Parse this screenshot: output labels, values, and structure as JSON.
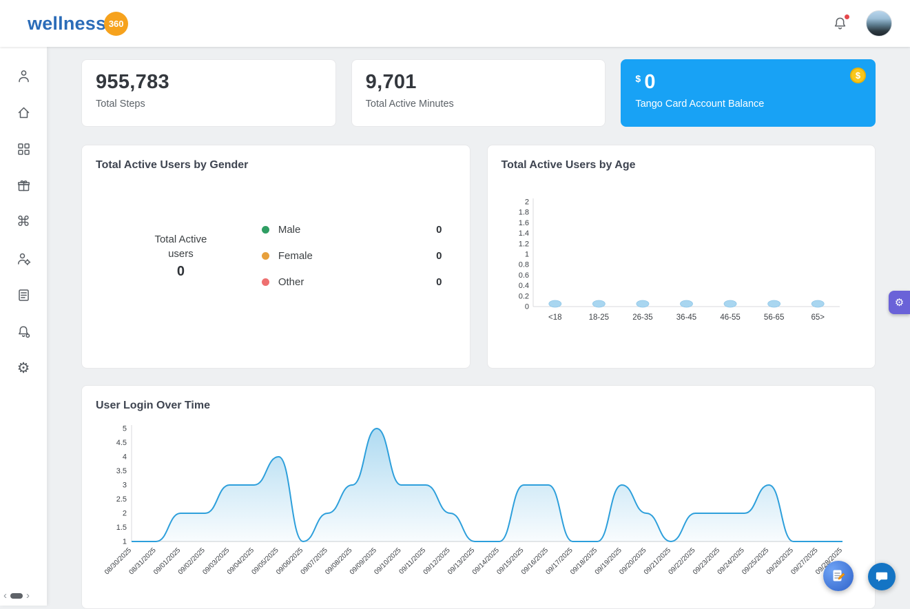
{
  "header": {
    "logo_text": "wellness",
    "logo_badge": "360"
  },
  "glyphs": {
    "command": "⌘",
    "settings": "⚙",
    "dollar": "$",
    "collapse_left": "‹",
    "collapse_right": "›"
  },
  "sidebar": {
    "icons": [
      "user-icon",
      "home-icon",
      "dashboard-grid-icon",
      "rewards-gift-icon",
      "command-icon",
      "user-settings-icon",
      "forms-list-icon",
      "notification-settings-icon",
      "settings-gear-icon"
    ]
  },
  "stats": {
    "steps": {
      "value": "955,783",
      "label": "Total Steps"
    },
    "minutes": {
      "value": "9,701",
      "label": "Total Active Minutes"
    },
    "balance": {
      "currency": "$",
      "value": "0",
      "label": "Tango Card Account Balance"
    }
  },
  "colors": {
    "balance_blue": "#18a2f5",
    "coin_yellow": "#f8c71d",
    "line_blue": "#2d9fdb",
    "purple_button": "#6a62d8",
    "chat_blue": "#1474c4"
  },
  "gender_chart": {
    "title": "Total Active Users by Gender",
    "center_label": "Total Active users",
    "center_value": "0",
    "legend": [
      {
        "label": "Male",
        "value": "0",
        "color": "#2f9e63"
      },
      {
        "label": "Female",
        "value": "0",
        "color": "#e7a03c"
      },
      {
        "label": "Other",
        "value": "0",
        "color": "#ee7070"
      }
    ]
  },
  "chart_data": [
    {
      "id": "age",
      "type": "bar",
      "title": "Total Active Users by Age",
      "categories": [
        "<18",
        "18-25",
        "26-35",
        "36-45",
        "46-55",
        "56-65",
        "65>"
      ],
      "values": [
        0,
        0,
        0,
        0,
        0,
        0,
        0
      ],
      "ylim": [
        0,
        2
      ],
      "ytick_step": 0.2,
      "marker_color": "#a9d6f0",
      "legend_position": "none",
      "grid": false
    },
    {
      "id": "login",
      "type": "area",
      "title": "User Login Over Time",
      "x": [
        "08/30/2025",
        "08/31/2025",
        "09/01/2025",
        "09/02/2025",
        "09/03/2025",
        "09/04/2025",
        "09/05/2025",
        "09/06/2025",
        "09/07/2025",
        "09/08/2025",
        "09/09/2025",
        "09/10/2025",
        "09/11/2025",
        "09/12/2025",
        "09/13/2025",
        "09/14/2025",
        "09/15/2025",
        "09/16/2025",
        "09/17/2025",
        "09/18/2025",
        "09/19/2025",
        "09/20/2025",
        "09/21/2025",
        "09/22/2025",
        "09/23/2025",
        "09/24/2025",
        "09/25/2025",
        "09/26/2025",
        "09/27/2025",
        "09/28/2025"
      ],
      "values": [
        1,
        1,
        2,
        2,
        3,
        3,
        4,
        1,
        2,
        3,
        5,
        3,
        3,
        2,
        1,
        1,
        3,
        3,
        1,
        1,
        3,
        2,
        1,
        2,
        2,
        2,
        3,
        1,
        1,
        1
      ],
      "ylim": [
        1,
        5
      ],
      "ytick_step": 0.5,
      "line_color": "#2d9fdb",
      "legend_position": "none",
      "grid": false
    }
  ]
}
